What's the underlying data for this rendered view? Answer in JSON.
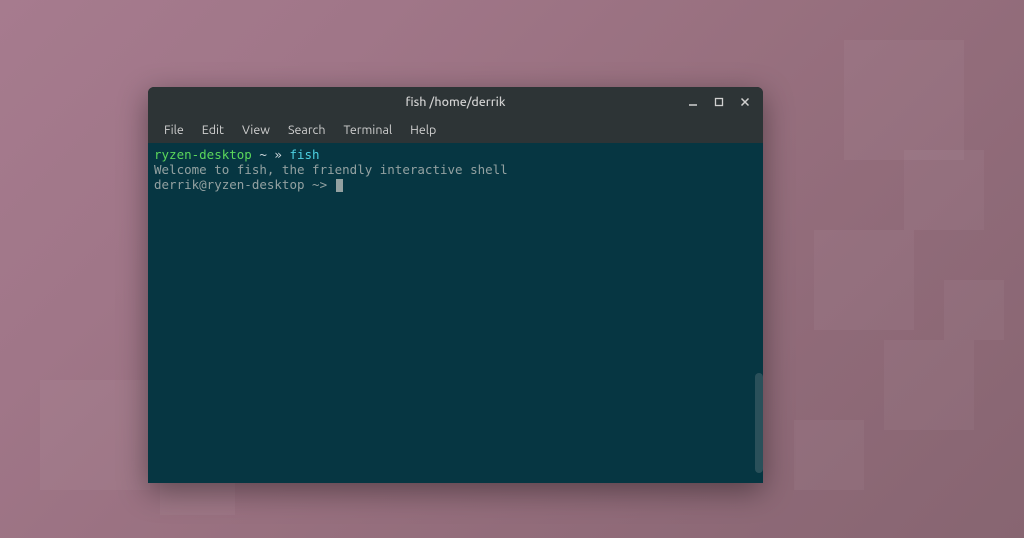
{
  "window": {
    "title": "fish  /home/derrik"
  },
  "menubar": {
    "file": "File",
    "edit": "Edit",
    "view": "View",
    "search": "Search",
    "terminal": "Terminal",
    "help": "Help"
  },
  "terminal": {
    "line1": {
      "prompt_host": "ryzen-desktop",
      "prompt_sep": " ~ » ",
      "command": "fish"
    },
    "line2": "Welcome to fish, the friendly interactive shell",
    "line3": {
      "prompt": "derrik@ryzen-desktop ~> "
    }
  }
}
